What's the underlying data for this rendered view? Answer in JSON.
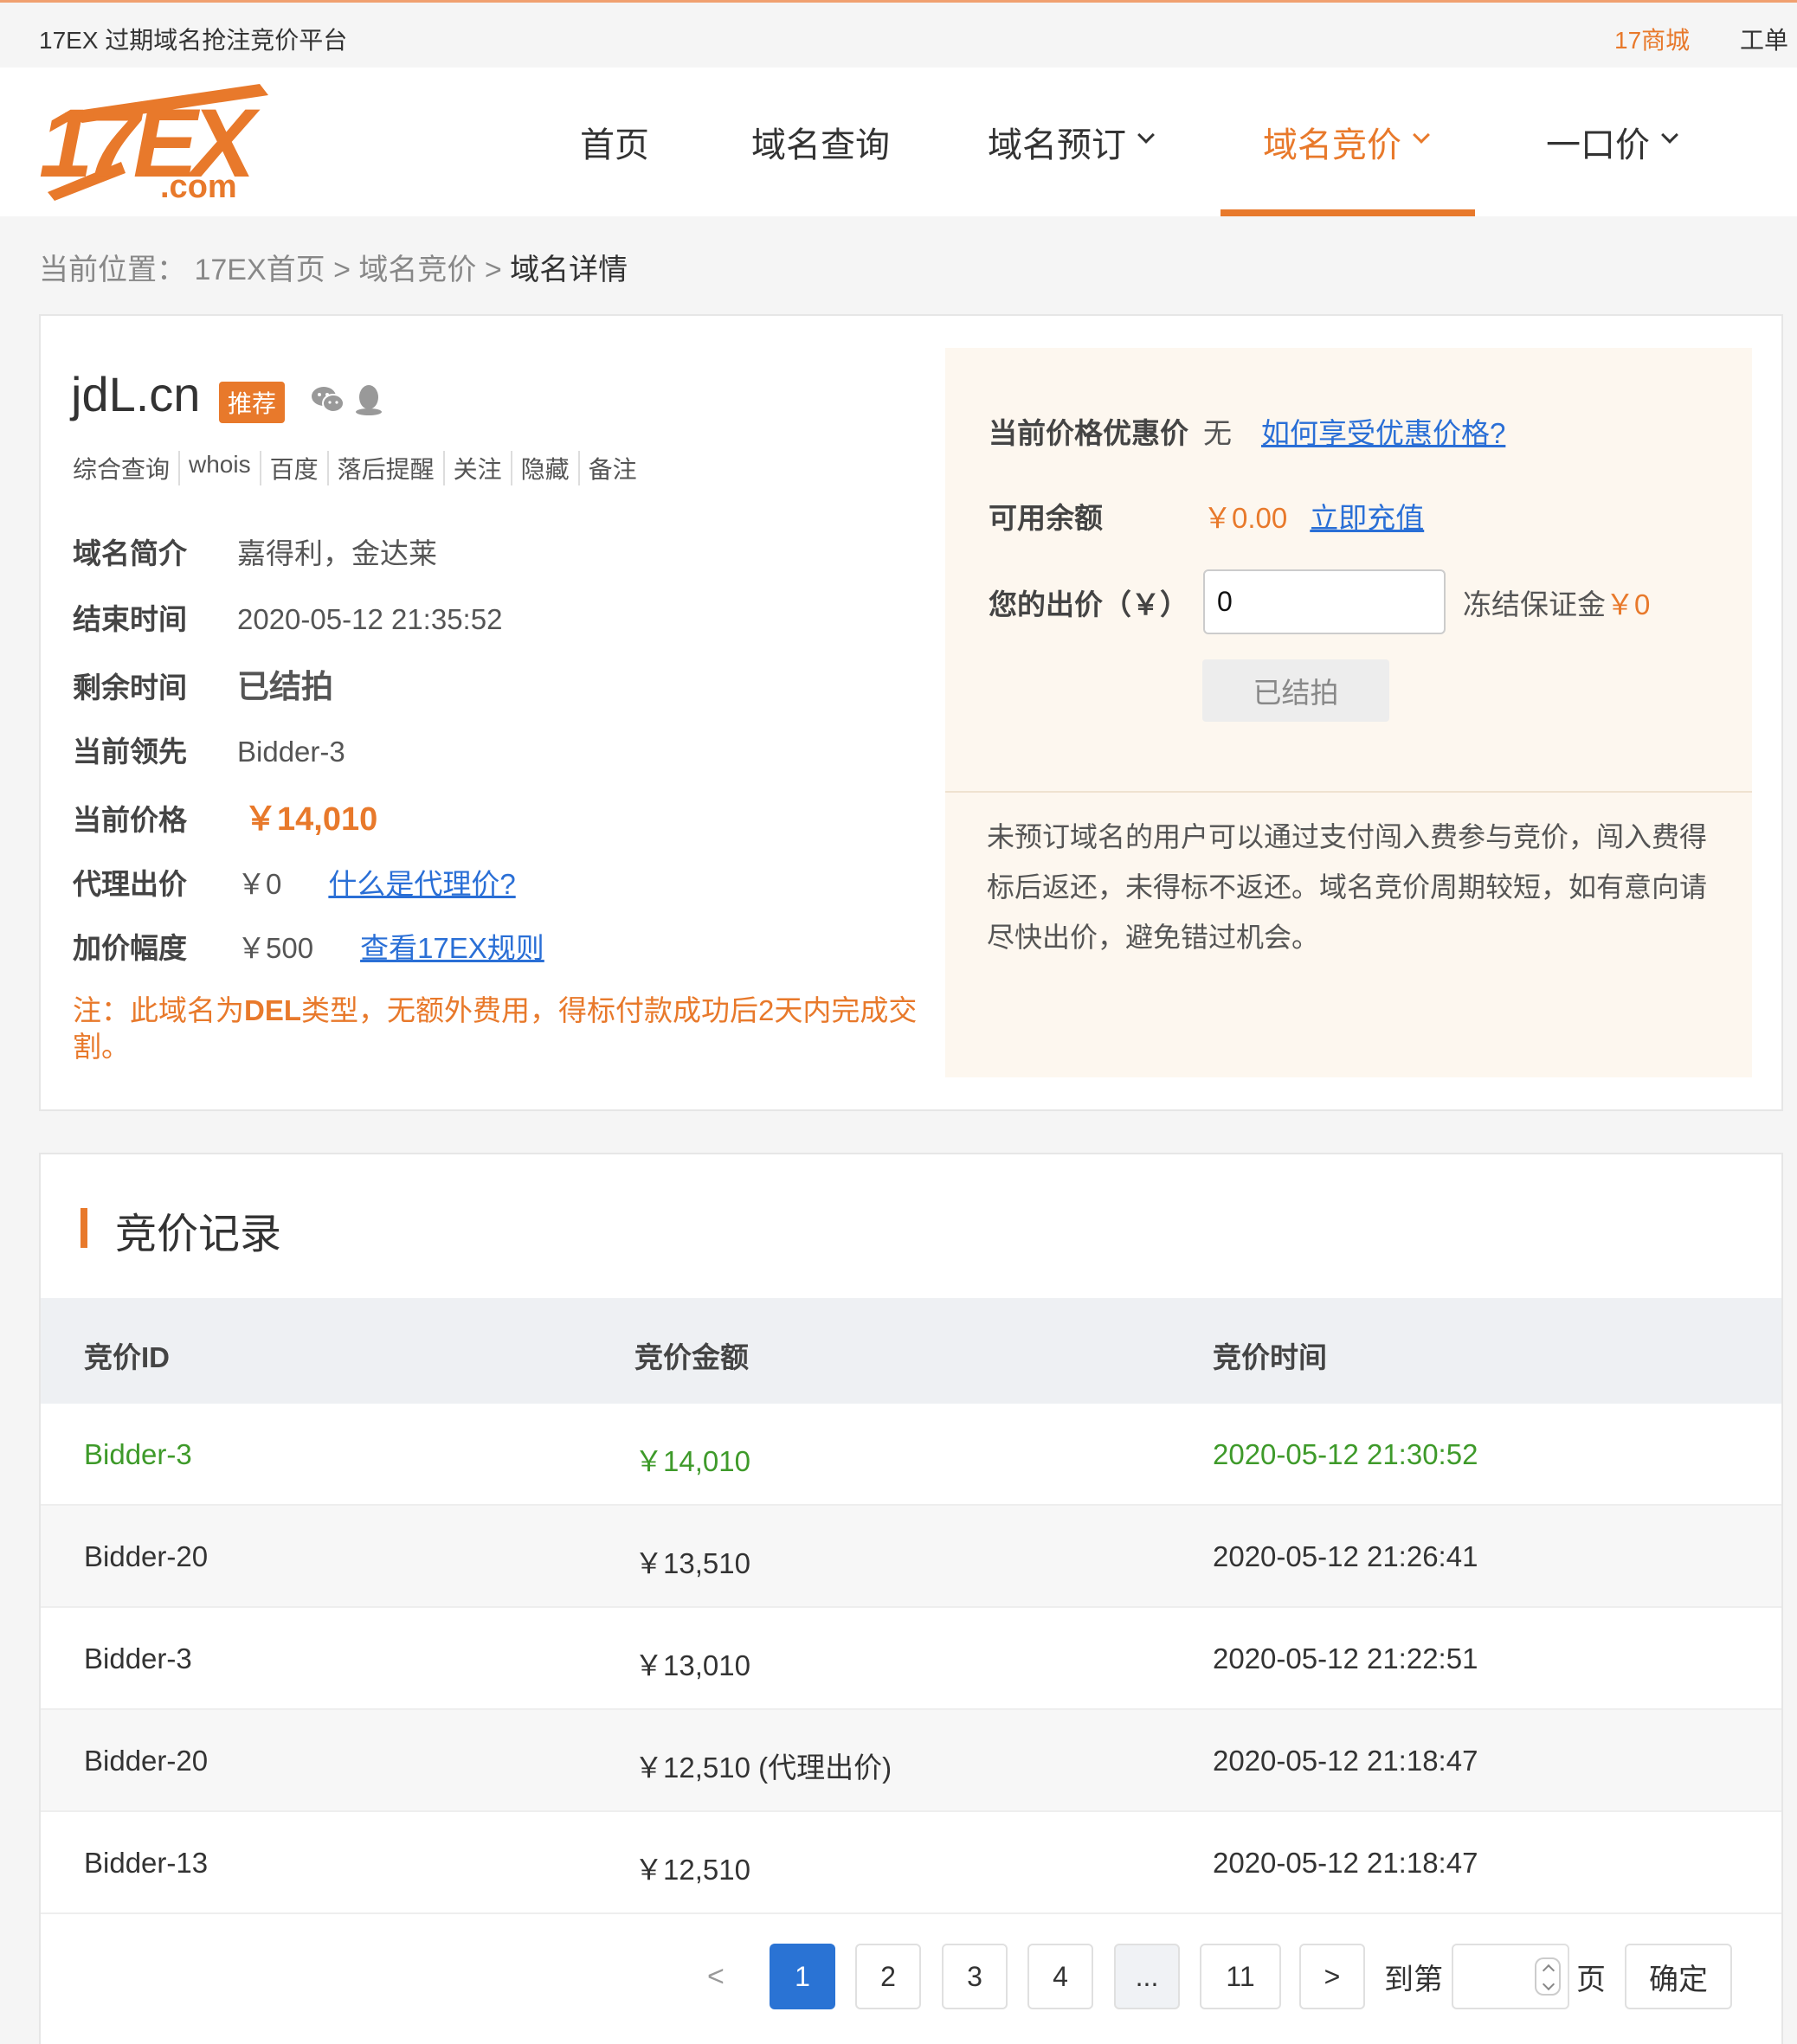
{
  "topbar": {
    "site_title": "17EX 过期域名抢注竞价平台",
    "mall": "17商城",
    "ticket": "工单"
  },
  "logo": {
    "main": "17EX",
    "sub": ".com"
  },
  "nav": {
    "items": [
      {
        "label": "首页"
      },
      {
        "label": "域名查询"
      },
      {
        "label": "域名预订"
      },
      {
        "label": "域名竞价"
      },
      {
        "label": "一口价"
      }
    ],
    "active": "域名竞价"
  },
  "breadcrumb": {
    "prefix": "当前位置：",
    "home": "17EX首页",
    "sep1": ">",
    "section": "域名竞价",
    "sep2": ">",
    "current": "域名详情"
  },
  "domain": {
    "name": "jdL.cn",
    "tag": "推荐",
    "links": [
      "综合查询",
      "whois",
      "百度",
      "落后提醒",
      "关注",
      "隐藏",
      "备注"
    ],
    "intro_label": "域名简介",
    "intro": "嘉得利，金达莱",
    "end_label": "结束时间",
    "end_time": "2020-05-12 21:35:52",
    "remain_label": "剩余时间",
    "remain": "已结拍",
    "leader_label": "当前领先",
    "leader": "Bidder-3",
    "price_label": "当前价格",
    "price": "￥14,010",
    "proxy_label": "代理出价",
    "proxy": "￥0",
    "proxy_link": "什么是代理价?",
    "inc_label": "加价幅度",
    "increment": "￥500",
    "rules_link": "查看17EX规则",
    "note_prefix": "注：此域名为",
    "note_type": "DEL",
    "note_suffix": "类型，无额外费用，得标付款成功后2天内完成交割。"
  },
  "bid_panel": {
    "discount_label": "当前价格优惠价",
    "discount": "无",
    "discount_link": "如何享受优惠价格?",
    "balance_label": "可用余额",
    "balance": "￥0.00",
    "recharge_link": "立即充值",
    "your_bid_label": "您的出价（￥）",
    "your_bid": "0",
    "deposit_label": "冻结保证金",
    "deposit": "￥0",
    "button": "已结拍",
    "desc": "未预订域名的用户可以通过支付闯入费参与竞价，闯入费得标后返还，未得标不返还。域名竞价周期较短，如有意向请尽快出价，避免错过机会。"
  },
  "records": {
    "title": "竞价记录",
    "columns": [
      "竞价ID",
      "竞价金额",
      "竞价时间"
    ],
    "rows": [
      {
        "id": "Bidder-3",
        "amount": "￥14,010",
        "time": "2020-05-12 21:30:52"
      },
      {
        "id": "Bidder-20",
        "amount": "￥13,510",
        "time": "2020-05-12 21:26:41"
      },
      {
        "id": "Bidder-3",
        "amount": "￥13,010",
        "time": "2020-05-12 21:22:51"
      },
      {
        "id": "Bidder-20",
        "amount": "￥12,510 (代理出价)",
        "time": "2020-05-12 21:18:47"
      },
      {
        "id": "Bidder-13",
        "amount": "￥12,510",
        "time": "2020-05-12 21:18:47"
      }
    ]
  },
  "pagination": {
    "prev": "<",
    "next": ">",
    "pages": [
      "1",
      "2",
      "3",
      "4",
      "...",
      "11"
    ],
    "current": "1",
    "goto_label": "到第",
    "page_unit": "页",
    "confirm": "确定"
  },
  "colors": {
    "accent": "#e8792b",
    "link": "#2a6fd6",
    "winner": "#3e9a2a",
    "page_active": "#2a73d4"
  }
}
